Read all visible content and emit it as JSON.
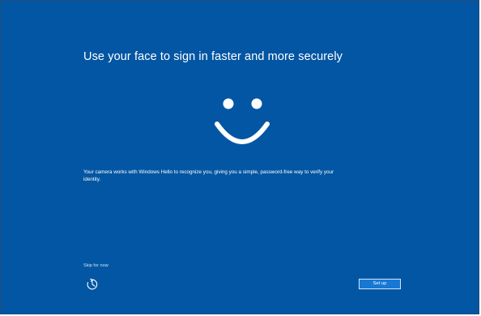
{
  "screen": {
    "title": "Use your face to sign in faster and more securely",
    "description": "Your camera works with Windows Hello to recognize you, giving you a simple, password-free way to verify your identity.",
    "skip_label": "Skip for now",
    "setup_label": "Set up",
    "icons": {
      "face": "smiley-face-icon",
      "accessibility": "ease-of-access-icon"
    }
  },
  "colors": {
    "background": "#0356a3",
    "button": "#1878d4",
    "text": "#ffffff"
  }
}
